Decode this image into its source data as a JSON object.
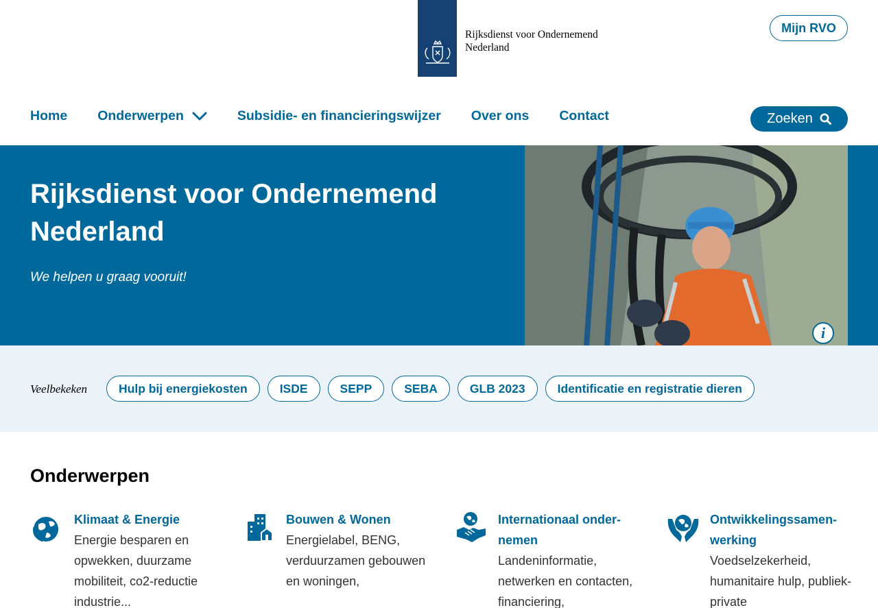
{
  "header": {
    "logo_line1": "Rijksdienst voor Ondernemend",
    "logo_line2": "Nederland",
    "mijn_rvo": "Mijn RVO"
  },
  "nav": {
    "items": [
      "Home",
      "Onderwerpen",
      "Subsidie- en financieringswijzer",
      "Over ons",
      "Contact"
    ],
    "search_label": "Zoeken"
  },
  "hero": {
    "title": "Rijksdienst voor Ondernemend Nederland",
    "subtitle": "We helpen u graag vooruit!"
  },
  "popular": {
    "label": "Veelbekeken",
    "pills": [
      "Hulp bij energiekosten",
      "ISDE",
      "SEPP",
      "SEBA",
      "GLB 2023",
      "Identificatie en registratie dieren"
    ]
  },
  "topics": {
    "title": "Onderwerpen",
    "items": [
      {
        "title": "Klimaat & Energie",
        "desc": "Energie besparen en opwekken, duurzame mobiliteit, co2-reductie industrie...",
        "icon": "globe-icon"
      },
      {
        "title": "Bouwen & Wonen",
        "desc": "Energielabel, BENG, verduurzamen gebouwen en woningen,",
        "icon": "buildings-icon"
      },
      {
        "title": "Internationaal onder-nemen",
        "desc": "Landeninformatie, netwerken en contacten, financiering,",
        "icon": "handshake-globe-icon"
      },
      {
        "title": "Ontwikkelingssamen-werking",
        "desc": "Voedselzekerheid, humanitaire hulp, publiek-private",
        "icon": "hands-globe-icon"
      }
    ]
  },
  "colors": {
    "brand": "#01689b",
    "logo_blue": "#154273",
    "light_band": "#ebf3f8"
  }
}
